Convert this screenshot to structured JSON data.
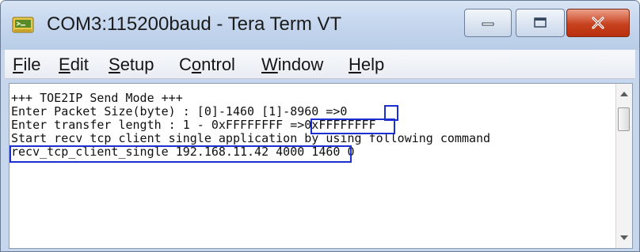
{
  "window": {
    "title": "COM3:115200baud - Tera Term VT"
  },
  "menu": [
    {
      "key": "F",
      "rest": "ile"
    },
    {
      "key": "E",
      "rest": "dit"
    },
    {
      "key": "S",
      "rest": "etup"
    },
    {
      "pre": "C",
      "key": "o",
      "rest": "ntrol"
    },
    {
      "key": "W",
      "rest": "indow"
    },
    {
      "key": "H",
      "rest": "elp"
    }
  ],
  "terminal": {
    "lines": [
      "+++ TOE2IP Send Mode +++",
      "Enter Packet Size(byte) : [0]-1460 [1]-8960 =>0",
      "Enter transfer length : 1 - 0xFFFFFFFF =>0xFFFFFFFF",
      "Start recv tcp client single application by using following command",
      "recv_tcp_client_single 192.168.11.42 4000 1460 0"
    ],
    "highlight_color": "#1c2fd2"
  },
  "colors": {
    "titlebar": "#c6d7ee",
    "close_button": "#c8421f",
    "terminal_bg": "#ffffff"
  }
}
